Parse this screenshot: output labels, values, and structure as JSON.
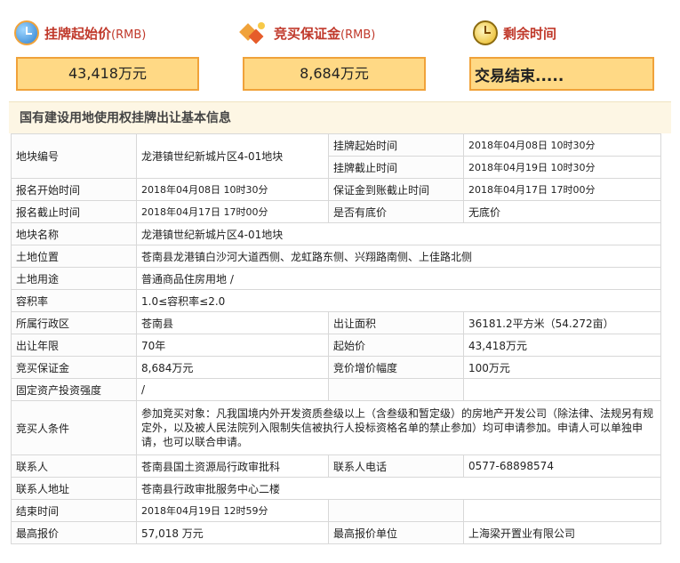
{
  "summary": {
    "price_label": "挂牌起始价",
    "price_unit": "(RMB)",
    "price_value": "43,418万元",
    "deposit_label": "竞买保证金",
    "deposit_unit": "(RMB)",
    "deposit_value": "8,684万元",
    "time_label": "剩余时间",
    "time_value": "交易结束....."
  },
  "section_title": "国有建设用地使用权挂牌出让基本信息",
  "info": {
    "plot_no_k": "地块编号",
    "plot_no_v": "龙港镇世纪新城片区4-01地块",
    "listing_start_k": "挂牌起始时间",
    "listing_start_v": "2018年04月08日 10时30分",
    "listing_end_k": "挂牌截止时间",
    "listing_end_v": "2018年04月19日 10时30分",
    "reg_start_k": "报名开始时间",
    "reg_start_v": "2018年04月08日 10时30分",
    "deposit_deadline_k": "保证金到账截止时间",
    "deposit_deadline_v": "2018年04月17日 17时00分",
    "reg_end_k": "报名截止时间",
    "reg_end_v": "2018年04月17日 17时00分",
    "reserve_k": "是否有底价",
    "reserve_v": "无底价",
    "plot_name_k": "地块名称",
    "plot_name_v": "龙港镇世纪新城片区4-01地块",
    "location_k": "土地位置",
    "location_v": "苍南县龙港镇白沙河大道西侧、龙虹路东侧、兴翔路南侧、上佳路北侧",
    "usage_k": "土地用途",
    "usage_v": "普通商品住房用地 /",
    "far_k": "容积率",
    "far_v": "1.0≤容积率≤2.0",
    "district_k": "所属行政区",
    "district_v": "苍南县",
    "area_k": "出让面积",
    "area_v": "36181.2平方米（54.272亩）",
    "term_k": "出让年限",
    "term_v": "70年",
    "start_price_k": "起始价",
    "start_price_v": "43,418万元",
    "bid_deposit_k": "竞买保证金",
    "bid_deposit_v": "8,684万元",
    "increment_k": "竞价增价幅度",
    "increment_v": "100万元",
    "invest_k": "固定资产投资强度",
    "invest_v": "/",
    "conditions_k": "竞买人条件",
    "conditions_v": "参加竞买对象：凡我国境内外开发资质叁级以上（含叁级和暂定级）的房地产开发公司（除法律、法规另有规定外，以及被人民法院列入限制失信被执行人投标资格名单的禁止参加）均可申请参加。申请人可以单独申请，也可以联合申请。",
    "contact_k": "联系人",
    "contact_v": "苍南县国土资源局行政审批科",
    "phone_k": "联系人电话",
    "phone_v": "0577-68898574",
    "address_k": "联系人地址",
    "address_v": "苍南县行政审批服务中心二楼",
    "end_time_k": "结束时间",
    "end_time_v": "2018年04月19日 12时59分",
    "top_bid_k": "最高报价",
    "top_bid_v": "57,018 万元",
    "top_bidder_k": "最高报价单位",
    "top_bidder_v": "上海梁开置业有限公司"
  }
}
